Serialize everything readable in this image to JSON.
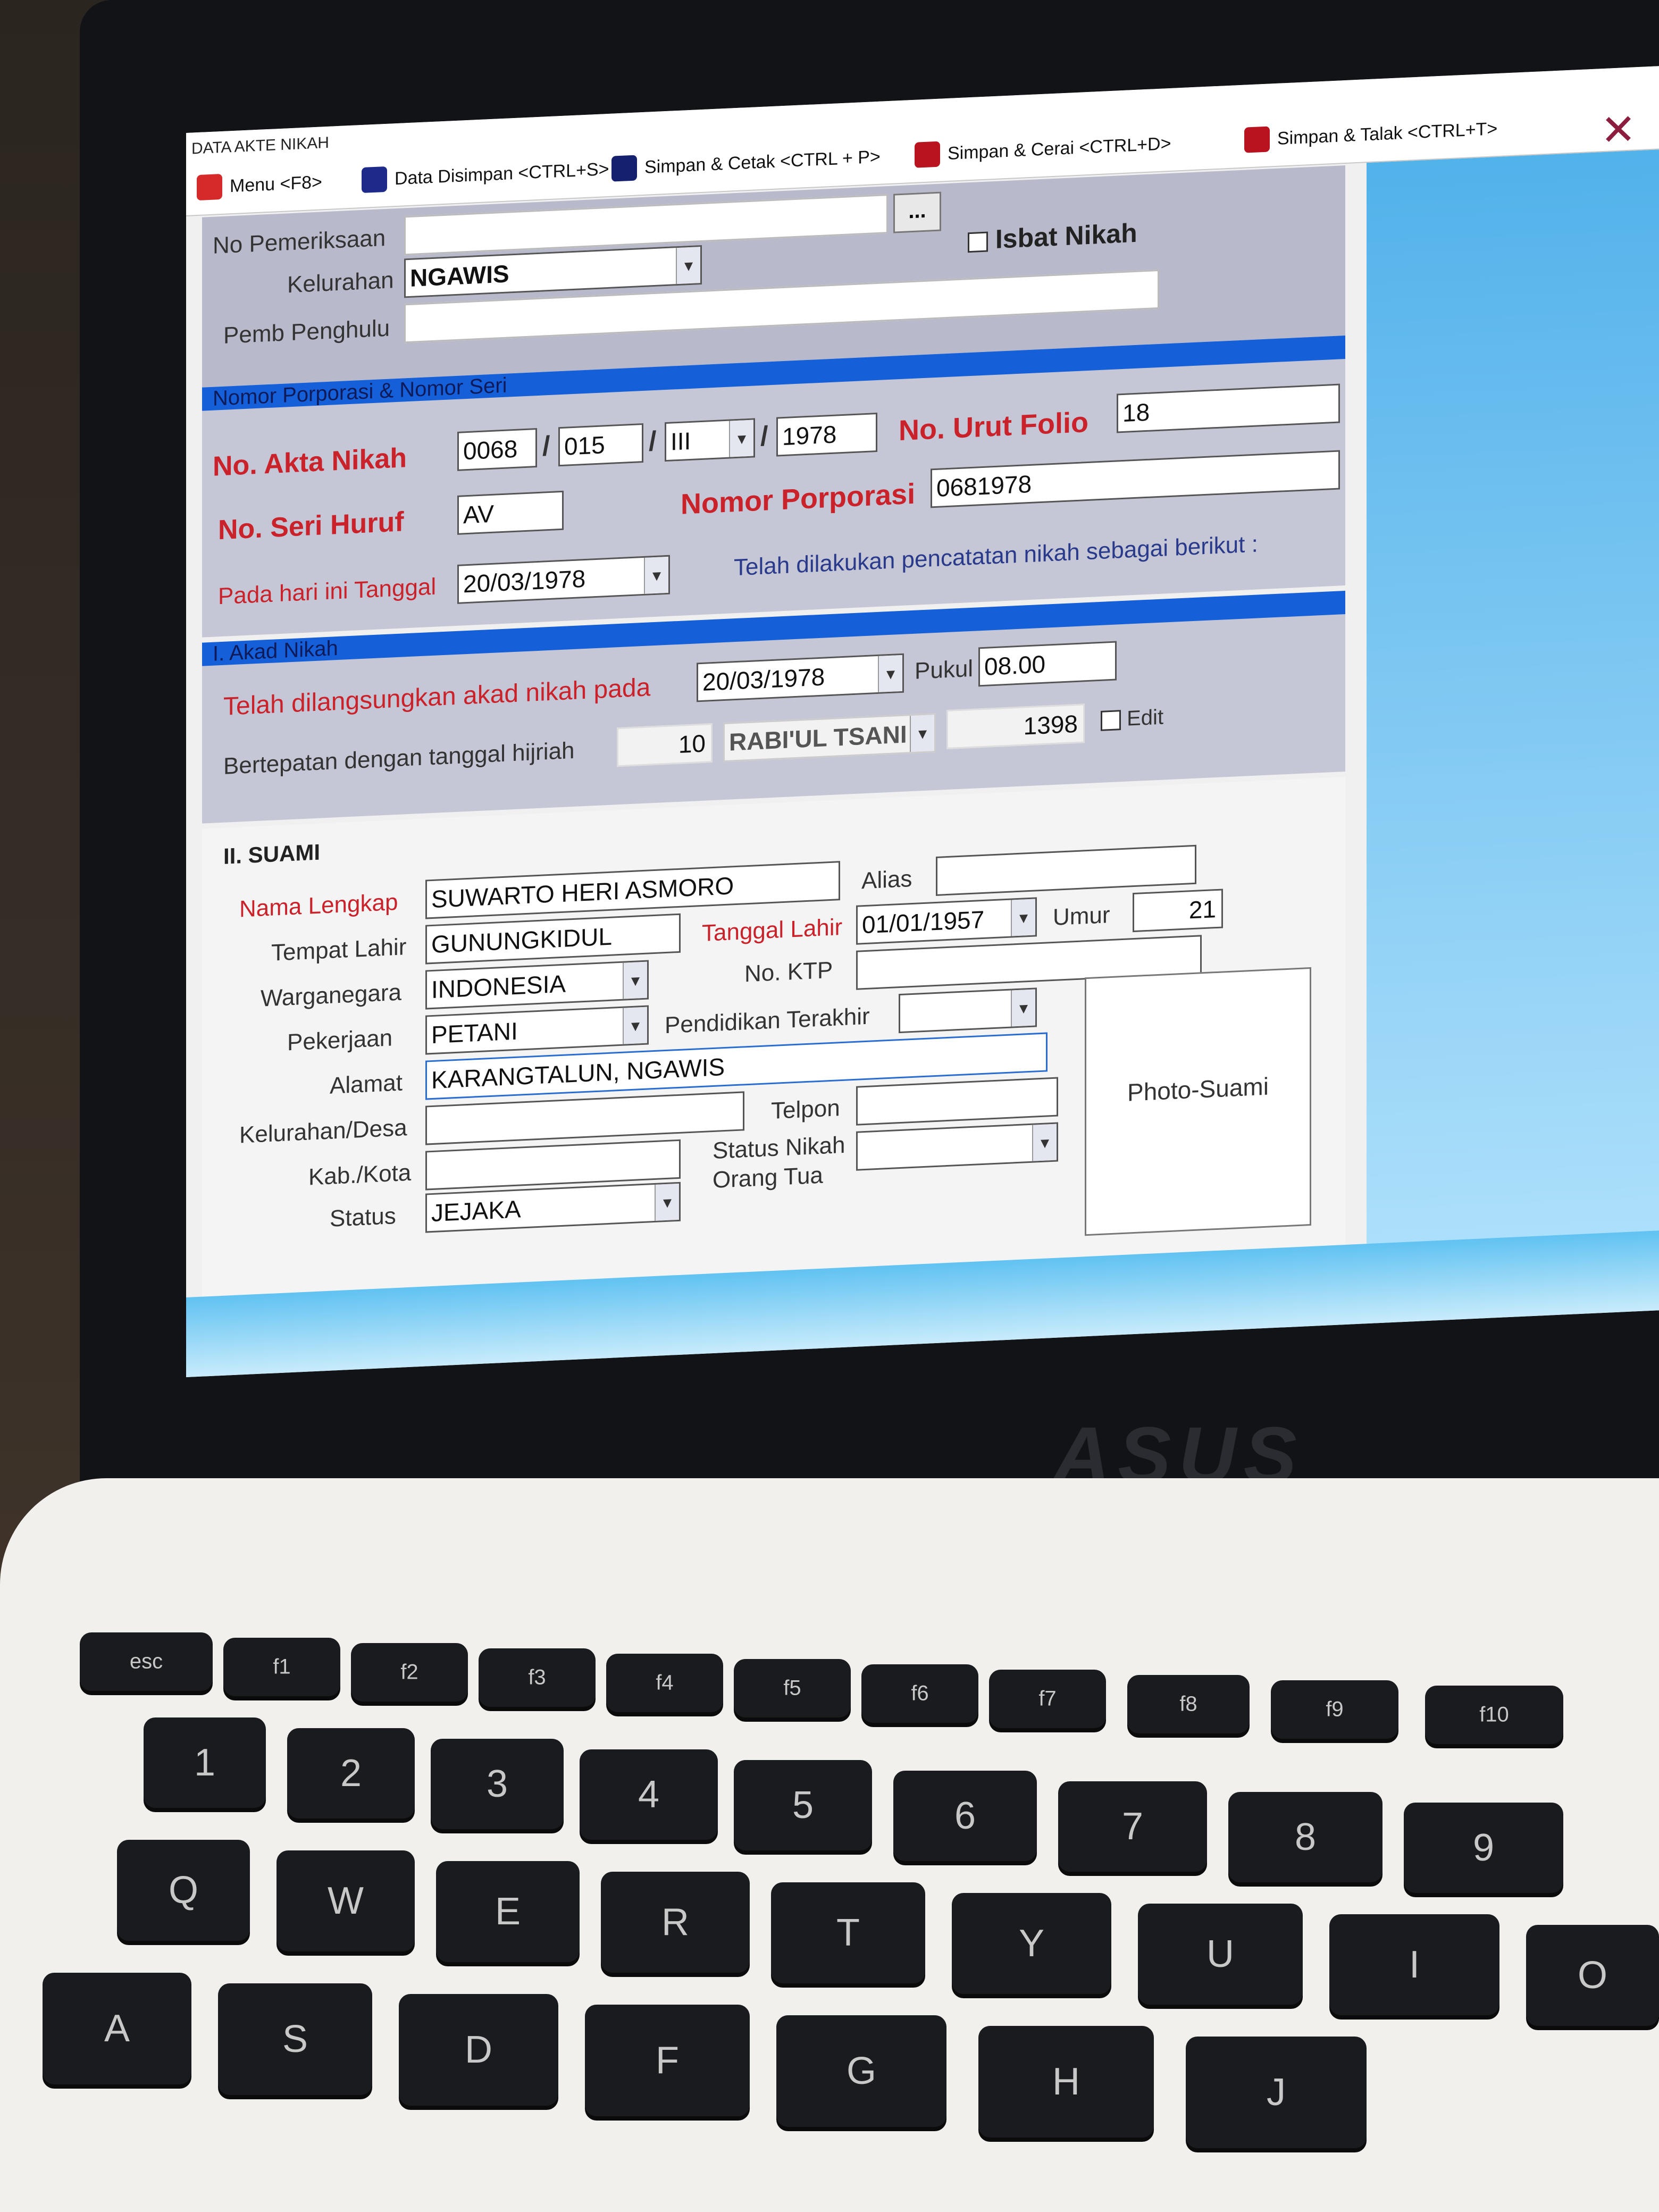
{
  "window": {
    "title": "DATA AKTE NIKAH"
  },
  "toolbar": {
    "menu": "Menu <F8>",
    "data_disimpan": "Data Disimpan <CTRL+S>",
    "simpan_cetak": "Simpan & Cetak <CTRL + P>",
    "simpan_cerai": "Simpan & Cerai <CTRL+D>",
    "simpan_talak": "Simpan & Talak <CTRL+T>",
    "close_glyph": "✕"
  },
  "header_form": {
    "no_pemeriksaan_label": "No  Pemeriksaan",
    "no_pemeriksaan_value": "",
    "browse_button": "...",
    "kelurahan_label": "Kelurahan",
    "kelurahan_value": "NGAWIS",
    "isbat_label": "Isbat Nikah",
    "pemb_penghulu_label": "Pemb  Penghulu",
    "pemb_penghulu_value": ""
  },
  "seri_section": {
    "title": "Nomor Porporasi & Nomor Seri",
    "akta_label": "No. Akta Nikah",
    "akta_parts": [
      "0068",
      "015",
      "III",
      "1978"
    ],
    "akta_sep": "/",
    "folio_label": "No. Urut Folio",
    "folio_value": "18",
    "seri_label": "No. Seri Huruf",
    "seri_value": "AV",
    "porporasi_label": "Nomor Porporasi",
    "porporasi_value": "0681978",
    "tanggal_label": "Pada hari ini Tanggal",
    "tanggal_value": "20/03/1978",
    "pencatatan_text": "Telah dilakukan pencatatan nikah sebagai berikut :"
  },
  "akad_section": {
    "title": "I. Akad Nikah",
    "dilangsungkan_label": "Telah dilangsungkan akad nikah pada",
    "dilangsungkan_value": "20/03/1978",
    "pukul_label": "Pukul",
    "pukul_value": "08.00",
    "hijriah_label": "Bertepatan dengan tanggal hijriah",
    "hijriah_day": "10",
    "hijriah_month": "RABI'UL TSANI",
    "hijriah_year": "1398",
    "edit_label": "Edit"
  },
  "suami_section": {
    "title": "II. SUAMI",
    "nama_label": "Nama Lengkap",
    "nama_value": "SUWARTO HERI ASMORO",
    "alias_label": "Alias",
    "alias_value": "",
    "tempat_label": "Tempat Lahir",
    "tempat_value": "GUNUNGKIDUL",
    "tgl_lahir_label": "Tanggal Lahir",
    "tgl_lahir_value": "01/01/1957",
    "umur_label": "Umur",
    "umur_value": "21",
    "warga_label": "Warganegara",
    "warga_value": "INDONESIA",
    "ktp_label": "No. KTP",
    "ktp_value": "",
    "pekerjaan_label": "Pekerjaan",
    "pekerjaan_value": "PETANI",
    "pendidikan_label": "Pendidikan Terakhir",
    "pendidikan_value": "",
    "alamat_label": "Alamat",
    "alamat_value": "KARANGTALUN, NGAWIS",
    "kel_desa_label": "Kelurahan/Desa",
    "kel_desa_value": "",
    "telpon_label": "Telpon",
    "telpon_value": "",
    "kab_label": "Kab./Kota",
    "kab_value": "",
    "status_nikah_label": "Status Nikah",
    "orang_tua_label": "Orang Tua",
    "status_nikah_value": "",
    "status_label": "Status",
    "status_value": "JEJAKA",
    "photo_label": "Photo-Suami"
  },
  "laptop": {
    "brand": "ASUS"
  },
  "keyboard": {
    "row_f": [
      "esc",
      "f1",
      "f2",
      "f3",
      "f4",
      "f5",
      "f6",
      "f7",
      "f8",
      "f9",
      "f10"
    ],
    "row_num": [
      "1",
      "2",
      "3",
      "4",
      "5",
      "6",
      "7",
      "8",
      "9"
    ],
    "row_q": [
      "Q",
      "W",
      "E",
      "R",
      "T",
      "Y",
      "U",
      "I",
      "O"
    ],
    "row_a": [
      "A",
      "S",
      "D",
      "F",
      "G",
      "H",
      "J"
    ]
  }
}
